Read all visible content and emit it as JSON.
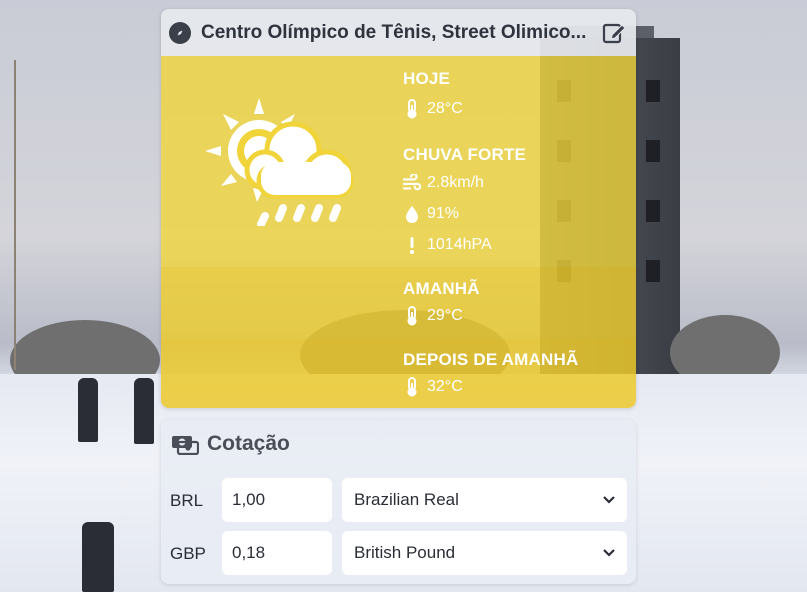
{
  "weather": {
    "location": "Centro Olímpico de Tênis, Street Olimico...",
    "today": {
      "label": "HOJE",
      "temperature": "28°C",
      "condition": "CHUVA FORTE",
      "wind": "2.8km/h",
      "humidity": "91%",
      "pressure": "1014hPA"
    },
    "tomorrow": {
      "label": "AMANHÃ",
      "temperature": "29°C"
    },
    "after_tomorrow": {
      "label": "DEPOIS DE AMANHÃ",
      "temperature": "32°C"
    },
    "icons": [
      "compass-icon",
      "edit-icon",
      "sun-cloud-rain-icon",
      "thermometer-icon",
      "wind-icon",
      "droplet-icon",
      "exclamation-icon"
    ],
    "colors": {
      "today_bg": "#f0d43a",
      "text": "#ffffff"
    }
  },
  "currency": {
    "title": "Cotação",
    "icon": "money-exchange-icon",
    "rows": [
      {
        "code": "BRL",
        "amount": "1,00",
        "currency": "Brazilian Real"
      },
      {
        "code": "GBP",
        "amount": "0,18",
        "currency": "British Pound"
      }
    ]
  }
}
